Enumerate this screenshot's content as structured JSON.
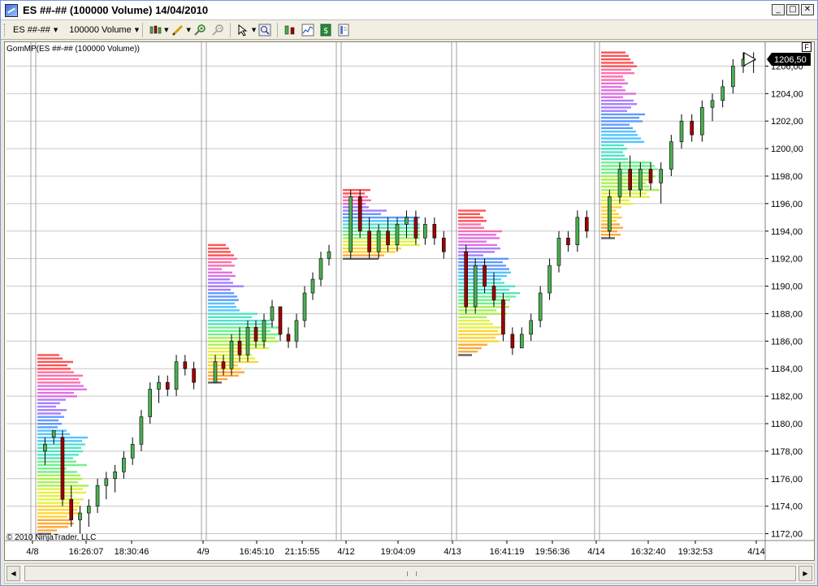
{
  "window": {
    "title": "ES ##-## (100000 Volume)  14/04/2010",
    "minimize": "_",
    "maximize": "□",
    "close": "✕"
  },
  "toolbar": {
    "instrument": "ES ##-##",
    "period": "100000 Volume",
    "icons": [
      "candlestick-icon",
      "pencil-icon",
      "zoom-in-icon",
      "zoom-out-icon",
      "cursor-icon",
      "magnifier-icon",
      "bars-icon",
      "indicators-icon",
      "strategies-icon",
      "properties-icon"
    ]
  },
  "chart": {
    "indicator_label": "GomMP(ES ##-## (100000 Volume))",
    "copyright": "© 2010 NinjaTrader, LLC",
    "f_button": "F",
    "current_price": "1206,50",
    "y_ticks": [
      "1206,00",
      "1204,00",
      "1202,00",
      "1200,00",
      "1198,00",
      "1196,00",
      "1194,00",
      "1192,00",
      "1190,00",
      "1188,00",
      "1186,00",
      "1184,00",
      "1182,00",
      "1180,00",
      "1178,00",
      "1176,00",
      "1174,00",
      "1172,00"
    ],
    "x_labels": [
      "4/8",
      "16:26:07",
      "18:30:46",
      "4/9",
      "16:45:10",
      "21:15:55",
      "4/12",
      "19:04:09",
      "4/13",
      "16:41:19",
      "19:56:36",
      "4/14",
      "16:32:40",
      "19:32:53",
      "4/14"
    ],
    "colors": {
      "up_candle": "#4caf50",
      "down_candle": "#a00000",
      "grid": "#c8c8c8",
      "session_line": "#a0a0a0"
    }
  },
  "chart_data": {
    "type": "candlestick-with-market-profile",
    "ylim": [
      1171.5,
      1207.5
    ],
    "sessions": [
      {
        "x_label": "4/8",
        "candles": [
          [
            1178,
            1179,
            1177,
            1178.5
          ],
          [
            1179,
            1179.5,
            1178.5,
            1179.5
          ],
          [
            1179,
            1179.5,
            1174,
            1174.5
          ],
          [
            1174.5,
            1175.5,
            1172.5,
            1173
          ],
          [
            1173,
            1174,
            1172,
            1173.5
          ],
          [
            1173.5,
            1174.5,
            1172.5,
            1174
          ],
          [
            1174,
            1176,
            1173.5,
            1175.5
          ],
          [
            1175.5,
            1176.5,
            1174.5,
            1176
          ],
          [
            1176,
            1177,
            1175,
            1176.5
          ],
          [
            1176.5,
            1178,
            1176,
            1177.5
          ],
          [
            1177.5,
            1179,
            1177,
            1178.5
          ],
          [
            1178.5,
            1181,
            1178,
            1180.5
          ],
          [
            1180.5,
            1183,
            1180,
            1182.5
          ],
          [
            1182.5,
            1183.5,
            1181.5,
            1183
          ],
          [
            1183,
            1183.5,
            1182,
            1182.5
          ],
          [
            1182.5,
            1185,
            1182,
            1184.5
          ],
          [
            1184.5,
            1185,
            1183.5,
            1184
          ],
          [
            1184,
            1184.5,
            1182.5,
            1183
          ]
        ]
      },
      {
        "x_label": "4/9",
        "candles": [
          [
            1183,
            1185,
            1183,
            1184.5
          ],
          [
            1184.5,
            1185,
            1183.5,
            1184
          ],
          [
            1184,
            1186.5,
            1183.5,
            1186
          ],
          [
            1186,
            1187,
            1184.5,
            1185
          ],
          [
            1185,
            1187.5,
            1184.5,
            1187
          ],
          [
            1187,
            1187.5,
            1185.5,
            1186
          ],
          [
            1186,
            1188,
            1185.5,
            1187.5
          ],
          [
            1187.5,
            1189,
            1187,
            1188.5
          ],
          [
            1188.5,
            1188.5,
            1186,
            1186.5
          ],
          [
            1186.5,
            1187,
            1185.5,
            1186
          ],
          [
            1186,
            1188,
            1185.5,
            1187.5
          ],
          [
            1187.5,
            1190,
            1187,
            1189.5
          ],
          [
            1189.5,
            1191,
            1189,
            1190.5
          ],
          [
            1190.5,
            1192.5,
            1190,
            1192
          ],
          [
            1192,
            1193,
            1191.5,
            1192.5
          ]
        ]
      },
      {
        "x_label": "4/12",
        "candles": [
          [
            1192.5,
            1197,
            1192,
            1196.5
          ],
          [
            1196.5,
            1197,
            1193.5,
            1194
          ],
          [
            1194,
            1195,
            1192,
            1192.5
          ],
          [
            1192.5,
            1194.5,
            1192,
            1194
          ],
          [
            1194,
            1195,
            1192.5,
            1193
          ],
          [
            1193,
            1195,
            1192.5,
            1194.5
          ],
          [
            1194.5,
            1195.5,
            1193.5,
            1195
          ],
          [
            1195,
            1195.5,
            1193,
            1193.5
          ],
          [
            1193.5,
            1195,
            1193,
            1194.5
          ],
          [
            1194.5,
            1195,
            1193,
            1193.5
          ],
          [
            1193.5,
            1194,
            1192,
            1192.5
          ]
        ]
      },
      {
        "x_label": "4/13",
        "candles": [
          [
            1192.5,
            1193,
            1188,
            1188.5
          ],
          [
            1188.5,
            1192,
            1188,
            1191.5
          ],
          [
            1191.5,
            1192,
            1189.5,
            1190
          ],
          [
            1190,
            1191,
            1188.5,
            1189
          ],
          [
            1189,
            1189.5,
            1186,
            1186.5
          ],
          [
            1186.5,
            1187,
            1185,
            1185.5
          ],
          [
            1185.5,
            1187,
            1185.5,
            1186.5
          ],
          [
            1186.5,
            1188,
            1186,
            1187.5
          ],
          [
            1187.5,
            1190,
            1187,
            1189.5
          ],
          [
            1189.5,
            1192,
            1189,
            1191.5
          ],
          [
            1191.5,
            1194,
            1191,
            1193.5
          ],
          [
            1193.5,
            1194,
            1192.5,
            1193
          ],
          [
            1193,
            1195.5,
            1192.5,
            1195
          ],
          [
            1195,
            1195.5,
            1193.5,
            1194
          ]
        ]
      },
      {
        "x_label": "4/14",
        "candles": [
          [
            1194,
            1197,
            1193.5,
            1196.5
          ],
          [
            1196.5,
            1199,
            1196,
            1198.5
          ],
          [
            1198.5,
            1199.5,
            1196.5,
            1197
          ],
          [
            1197,
            1199,
            1196.5,
            1198.5
          ],
          [
            1198.5,
            1199,
            1197,
            1197.5
          ],
          [
            1197.5,
            1199,
            1196,
            1198.5
          ],
          [
            1198.5,
            1201,
            1198,
            1200.5
          ],
          [
            1200.5,
            1202.5,
            1200,
            1202
          ],
          [
            1202,
            1202.5,
            1200.5,
            1201
          ],
          [
            1201,
            1203.5,
            1200.5,
            1203
          ],
          [
            1203,
            1204,
            1202,
            1203.5
          ],
          [
            1203.5,
            1205,
            1203,
            1204.5
          ],
          [
            1204.5,
            1206.5,
            1204,
            1206
          ],
          [
            1206,
            1207,
            1205.5,
            1206.5
          ],
          [
            1206.5,
            1207,
            1205.5,
            1206.5
          ]
        ]
      }
    ],
    "xlabel": "",
    "ylabel": ""
  }
}
